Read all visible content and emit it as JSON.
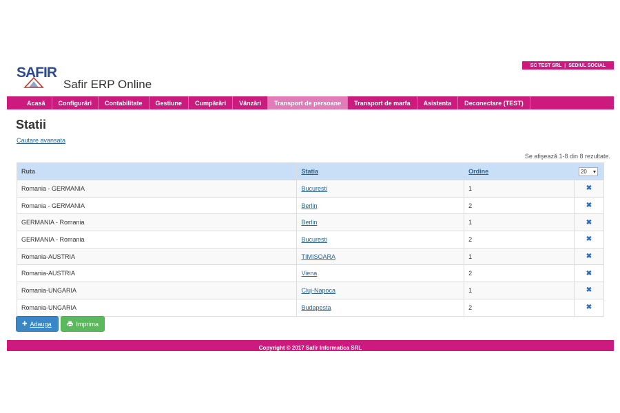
{
  "company_bar": {
    "company": "SC TEST SRL",
    "office": "SEDIUL SOCIAL"
  },
  "logo": {
    "text": "SAFIR"
  },
  "app_title": "Safir ERP Online",
  "nav": [
    {
      "label": "Acasă"
    },
    {
      "label": "Configurări"
    },
    {
      "label": "Contabilitate"
    },
    {
      "label": "Gestiune"
    },
    {
      "label": "Cumpărări"
    },
    {
      "label": "Vânzări"
    },
    {
      "label": "Transport de persoane"
    },
    {
      "label": "Transport de marfa"
    },
    {
      "label": "Asistenta"
    },
    {
      "label": "Deconectare (TEST)"
    }
  ],
  "page_title": "Statii",
  "advanced_search": "Cautare avansata",
  "results_text": "Se afişează 1-8 din 8 rezultate.",
  "table": {
    "headers": {
      "ruta": "Ruta",
      "statia": "Statia",
      "ordine": "Ordine",
      "page_size": "20"
    },
    "rows": [
      {
        "ruta": "Romania - GERMANIA",
        "statia": "Bucuresti",
        "ordine": "1"
      },
      {
        "ruta": "Romania - GERMANIA",
        "statia": "Berlin",
        "ordine": "2"
      },
      {
        "ruta": "GERMANIA - Romania",
        "statia": "Berlin",
        "ordine": "1"
      },
      {
        "ruta": "GERMANIA - Romania",
        "statia": "Bucuresti",
        "ordine": "2"
      },
      {
        "ruta": "Romania-AUSTRIA",
        "statia": "TIMISOARA",
        "ordine": "1"
      },
      {
        "ruta": "Romania-AUSTRIA",
        "statia": "Viena",
        "ordine": "2"
      },
      {
        "ruta": "Romania-UNGARIA",
        "statia": "Cluj-Napoca",
        "ordine": "1"
      },
      {
        "ruta": "Romania-UNGARIA",
        "statia": "Budapesta",
        "ordine": "2"
      }
    ]
  },
  "buttons": {
    "add": "Adauga",
    "print": "Imprima"
  },
  "footer": "Copyright © 2017 Safir Informatica SRL",
  "colors": {
    "brand": "#cc1a7f",
    "nav_active": "#e27bb7",
    "header_row": "#c9def7",
    "link": "#2a6496",
    "add": "#3a87c8",
    "print": "#5cb85c"
  }
}
